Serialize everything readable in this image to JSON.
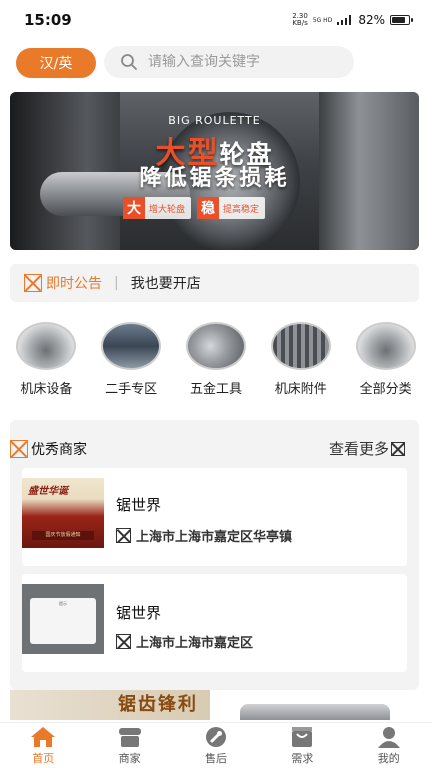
{
  "status": {
    "time": "15:09",
    "net_speed_value": "2.30",
    "net_speed_unit": "KB/s",
    "signal": "5G HD",
    "battery": "82%",
    "battery_level": 0.82
  },
  "header": {
    "lang_label": "汉/英",
    "search_placeholder": "请输入查询关键字"
  },
  "banner": {
    "subtitle": "BIG ROULETTE",
    "title_accent": "大型",
    "title_rest": "轮盘",
    "title_line2": "降低锯条损耗",
    "tags": [
      {
        "key": "大",
        "text": "增大轮盘"
      },
      {
        "key": "稳",
        "text": "提高稳定"
      }
    ]
  },
  "notice": {
    "label": "即时公告",
    "text": "我也要开店"
  },
  "categories": [
    {
      "label": "机床设备"
    },
    {
      "label": "二手专区"
    },
    {
      "label": "五金工具"
    },
    {
      "label": "机床附件"
    },
    {
      "label": "全部分类"
    }
  ],
  "merchants": {
    "title": "优秀商家",
    "more": "查看更多",
    "items": [
      {
        "name": "锯世界",
        "address": "上海市上海市嘉定区华亭镇",
        "thumb_title": "盛世华诞",
        "thumb_sub": "国庆节放假通知",
        "thumb_cap": "国庆节放假通知"
      },
      {
        "name": "锯世界",
        "address": "上海市上海市嘉定区",
        "thumb_dialog": "提示"
      }
    ]
  },
  "promo": {
    "text": "锯齿锋利"
  },
  "tabbar": [
    {
      "label": "首页",
      "active": true
    },
    {
      "label": "商家"
    },
    {
      "label": "售后"
    },
    {
      "label": "需求"
    },
    {
      "label": "我的"
    }
  ],
  "colors": {
    "accent": "#e87a2a",
    "banner_red": "#e8502a"
  }
}
